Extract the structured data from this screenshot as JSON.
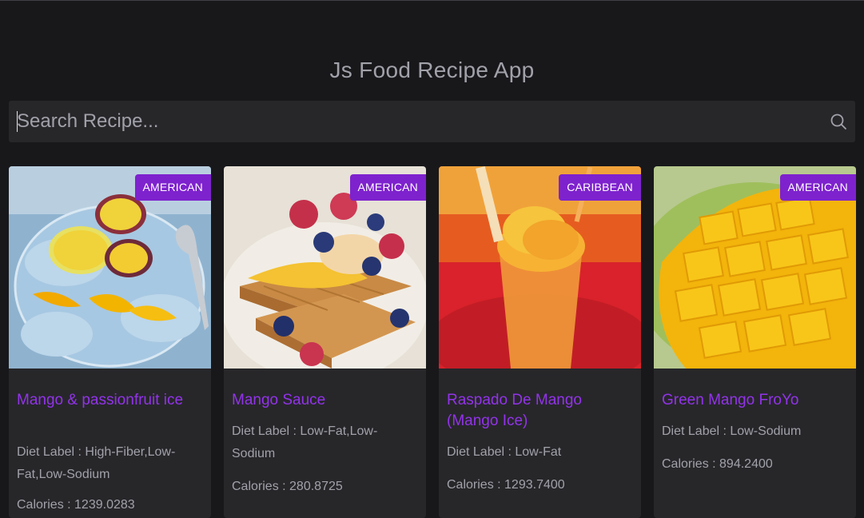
{
  "app": {
    "title": "Js Food Recipe App"
  },
  "search": {
    "placeholder": "Search Recipe...",
    "value": "",
    "icon": "search-icon"
  },
  "recipes": [
    {
      "cuisine": "AMERICAN",
      "title": "Mango & passionfruit ice",
      "diet": "Diet Label : High-Fiber,Low-Fat,Low-Sodium",
      "calories": "Calories : 1239.0283"
    },
    {
      "cuisine": "AMERICAN",
      "title": "Mango Sauce",
      "diet": "Diet Label : Low-Fat,Low-Sodium",
      "calories": "Calories : 280.8725"
    },
    {
      "cuisine": "CARIBBEAN",
      "title": "Raspado De Mango (Mango Ice)",
      "diet": "Diet Label : Low-Fat",
      "calories": "Calories : 1293.7400"
    },
    {
      "cuisine": "AMERICAN",
      "title": "Green Mango FroYo",
      "diet": "Diet Label : Low-Sodium",
      "calories": "Calories : 894.2400"
    }
  ],
  "colors": {
    "background": "#18181b",
    "surface": "#27272a",
    "accent": "#9333ea",
    "badge": "#7e22ce"
  }
}
